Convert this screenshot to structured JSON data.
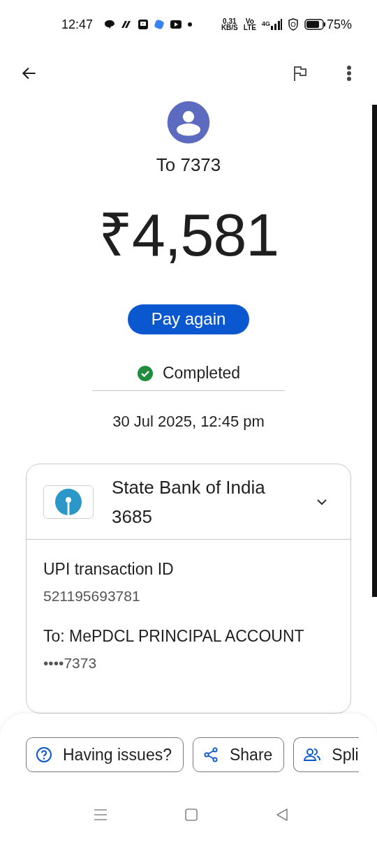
{
  "status_bar": {
    "time": "12:47",
    "net_speed": "0.31",
    "net_speed_unit": "KB/S",
    "volte": "Vo",
    "volte_sub": "LTE",
    "network": "4G",
    "battery": "75%"
  },
  "payee": "To 7373",
  "amount": "₹4,581",
  "pay_again": "Pay again",
  "status": {
    "label": "Completed",
    "kind": "completed"
  },
  "date": "30 Jul 2025, 12:45 pm",
  "bank": {
    "name": "State Bank of India",
    "account": "3685",
    "expanded": false
  },
  "details": [
    {
      "label": "UPI transaction ID",
      "value": "521195693781"
    },
    {
      "label": "To: MePDCL PRINCIPAL ACCOUNT",
      "value": "••••7373"
    }
  ],
  "actions": [
    {
      "label": "Having issues?",
      "kind": "help"
    },
    {
      "label": "Share",
      "kind": "share"
    },
    {
      "label": "Spli",
      "kind": "split"
    }
  ]
}
